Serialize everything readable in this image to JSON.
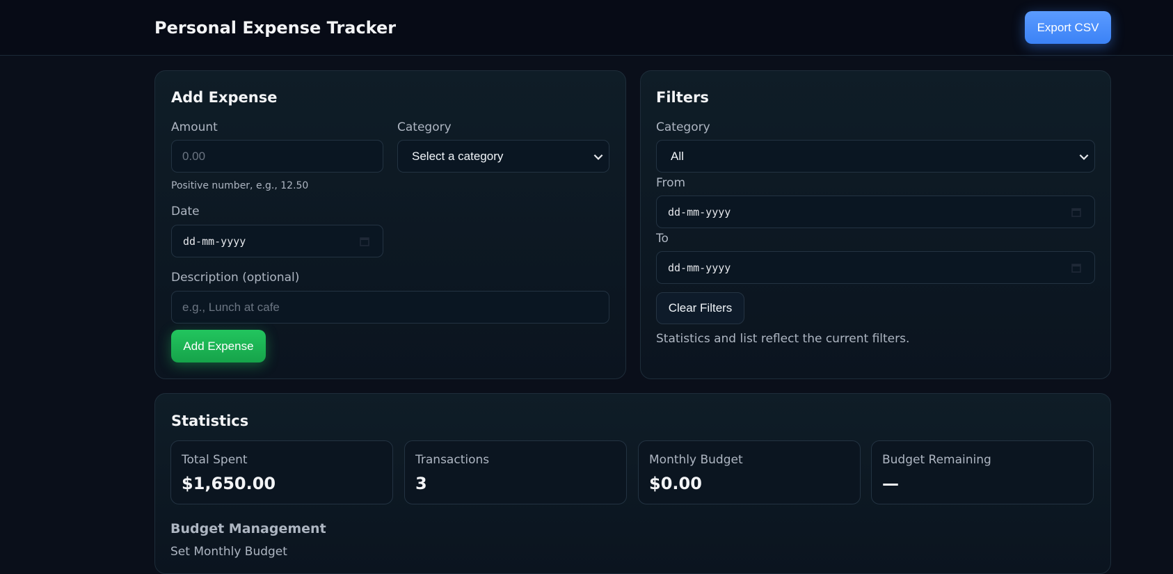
{
  "header": {
    "title": "Personal Expense Tracker",
    "export_label": "Export CSV"
  },
  "add_expense": {
    "title": "Add Expense",
    "amount_label": "Amount",
    "amount_placeholder": "0.00",
    "amount_hint": "Positive number, e.g., 12.50",
    "category_label": "Category",
    "category_selected": "Select a category",
    "date_label": "Date",
    "date_placeholder": "dd-mm-yyyy",
    "description_label": "Description (optional)",
    "description_placeholder": "e.g., Lunch at cafe",
    "submit_label": "Add Expense"
  },
  "filters": {
    "title": "Filters",
    "category_label": "Category",
    "category_selected": "All",
    "from_label": "From",
    "from_placeholder": "dd-mm-yyyy",
    "to_label": "To",
    "to_placeholder": "dd-mm-yyyy",
    "clear_label": "Clear Filters",
    "note": "Statistics and list reflect the current filters."
  },
  "statistics": {
    "title": "Statistics",
    "cards": [
      {
        "label": "Total Spent",
        "value": "$1,650.00"
      },
      {
        "label": "Transactions",
        "value": "3"
      },
      {
        "label": "Monthly Budget",
        "value": "$0.00"
      },
      {
        "label": "Budget Remaining",
        "value": "—"
      }
    ],
    "budget_heading": "Budget Management",
    "set_budget_label": "Set Monthly Budget"
  },
  "icons": {
    "chevron": "chevron-down-icon",
    "calendar": "calendar-icon"
  },
  "colors": {
    "export_accent": "#3b82f6",
    "add_accent": "#22c55e",
    "background": "#0a0f1a"
  }
}
